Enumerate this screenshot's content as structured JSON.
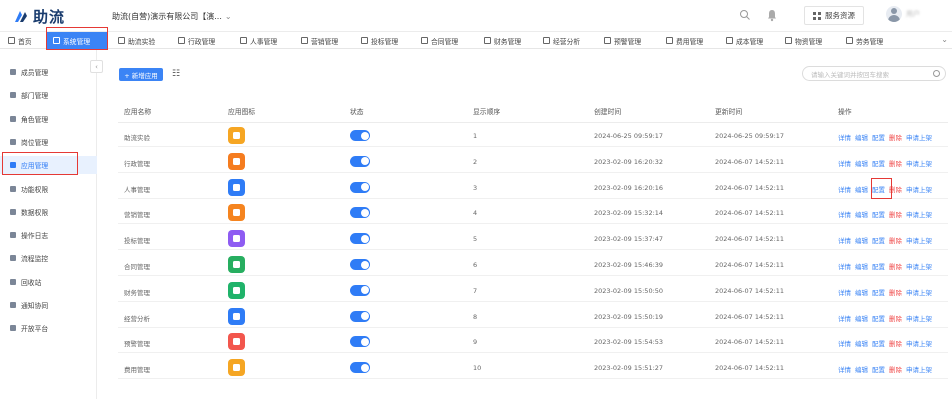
{
  "header": {
    "logo_text": "助流",
    "company": "助流(自营)演示有限公司【演...",
    "service_button": "服务资源",
    "user_name": "用户"
  },
  "modules": [
    {
      "label": "首页",
      "icon": "home-icon"
    },
    {
      "label": "系统管理",
      "icon": "grid-icon",
      "active": true
    },
    {
      "label": "助流实验",
      "icon": "flask-icon"
    },
    {
      "label": "行政管理",
      "icon": "doc-icon"
    },
    {
      "label": "人事管理",
      "icon": "people-icon"
    },
    {
      "label": "营销管理",
      "icon": "cart-icon"
    },
    {
      "label": "投标管理",
      "icon": "target-icon"
    },
    {
      "label": "合同管理",
      "icon": "contract-icon"
    },
    {
      "label": "财务管理",
      "icon": "money-icon"
    },
    {
      "label": "经营分析",
      "icon": "chart-icon"
    },
    {
      "label": "预警管理",
      "icon": "alert-icon"
    },
    {
      "label": "费用管理",
      "icon": "receipt-icon"
    },
    {
      "label": "成本管理",
      "icon": "coin-icon"
    },
    {
      "label": "物资管理",
      "icon": "truck-icon"
    },
    {
      "label": "劳务管理",
      "icon": "worker-icon"
    }
  ],
  "sidebar": {
    "items": [
      {
        "label": "成员管理"
      },
      {
        "label": "部门管理"
      },
      {
        "label": "角色管理"
      },
      {
        "label": "岗位管理"
      },
      {
        "label": "应用管理",
        "active": true
      },
      {
        "label": "功能权限"
      },
      {
        "label": "数据权限"
      },
      {
        "label": "操作日志"
      },
      {
        "label": "流程监控"
      },
      {
        "label": "回收站"
      },
      {
        "label": "通知协同"
      },
      {
        "label": "开放平台"
      }
    ]
  },
  "toolbar": {
    "add_label": "+ 新增应用",
    "search_placeholder": "请输入关键词并按回车搜索"
  },
  "table": {
    "headers": [
      "应用名称",
      "应用图标",
      "状态",
      "显示顺序",
      "创建时间",
      "更新时间",
      "操作"
    ],
    "actions": [
      "详情",
      "编辑",
      "配置",
      "删除",
      "申请上架"
    ],
    "rows": [
      {
        "name": "助流实验",
        "icon_color": "#f6a623",
        "order": "1",
        "created": "2024-06-25 09:59:17",
        "updated": "2024-06-25 09:59:17"
      },
      {
        "name": "行政管理",
        "icon_color": "#f57c1f",
        "order": "2",
        "created": "2023-02-09 16:20:32",
        "updated": "2024-06-07 14:52:11"
      },
      {
        "name": "人事管理",
        "icon_color": "#2f7cf6",
        "order": "3",
        "created": "2023-02-09 16:20:16",
        "updated": "2024-06-07 14:52:11"
      },
      {
        "name": "营销管理",
        "icon_color": "#f5841f",
        "order": "4",
        "created": "2023-02-09 15:32:14",
        "updated": "2024-06-07 14:52:11"
      },
      {
        "name": "投标管理",
        "icon_color": "#8e5cf2",
        "order": "5",
        "created": "2023-02-09 15:37:47",
        "updated": "2024-06-07 14:52:11"
      },
      {
        "name": "合同管理",
        "icon_color": "#27ae60",
        "order": "6",
        "created": "2023-02-09 15:46:39",
        "updated": "2024-06-07 14:52:11"
      },
      {
        "name": "财务管理",
        "icon_color": "#20b36a",
        "order": "7",
        "created": "2023-02-09 15:50:50",
        "updated": "2024-06-07 14:52:11"
      },
      {
        "name": "经营分析",
        "icon_color": "#2f7cf6",
        "order": "8",
        "created": "2023-02-09 15:50:19",
        "updated": "2024-06-07 14:52:11"
      },
      {
        "name": "预警管理",
        "icon_color": "#f2564d",
        "order": "9",
        "created": "2023-02-09 15:54:53",
        "updated": "2024-06-07 14:52:11"
      },
      {
        "name": "费用管理",
        "icon_color": "#f5a623",
        "order": "10",
        "created": "2023-02-09 15:51:27",
        "updated": "2024-06-07 14:52:11"
      }
    ]
  }
}
